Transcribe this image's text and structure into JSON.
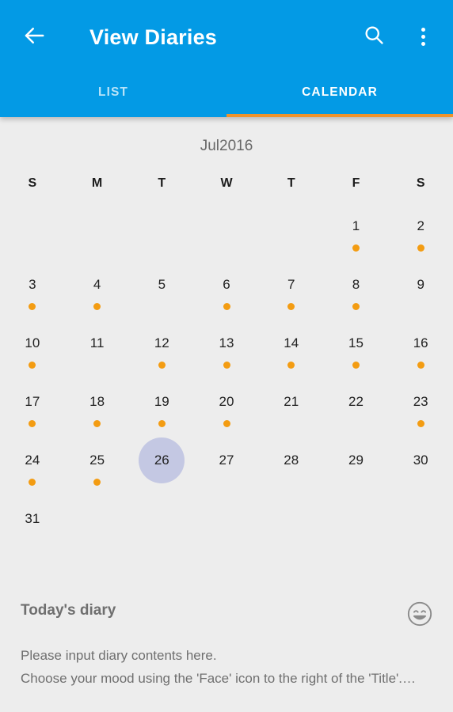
{
  "app_bar": {
    "title": "View Diaries",
    "back_icon": "arrow-left-icon",
    "search_icon": "search-icon",
    "overflow_icon": "more-vert-icon",
    "background_color": "#039ae5"
  },
  "tabs": {
    "items": [
      {
        "label": "LIST",
        "active": false
      },
      {
        "label": "CALENDAR",
        "active": true
      }
    ],
    "indicator_color": "#f0932b"
  },
  "calendar": {
    "month_label": "Jul2016",
    "weekday_headers": [
      "S",
      "M",
      "T",
      "W",
      "T",
      "F",
      "S"
    ],
    "selected_day": 26,
    "dot_color": "#f39c12",
    "selected_circle_color": "#c4c8e3",
    "weeks": [
      [
        {
          "day": "",
          "dot": false
        },
        {
          "day": "",
          "dot": false
        },
        {
          "day": "",
          "dot": false
        },
        {
          "day": "",
          "dot": false
        },
        {
          "day": "",
          "dot": false
        },
        {
          "day": "1",
          "dot": true
        },
        {
          "day": "2",
          "dot": true
        }
      ],
      [
        {
          "day": "3",
          "dot": true
        },
        {
          "day": "4",
          "dot": true
        },
        {
          "day": "5",
          "dot": false
        },
        {
          "day": "6",
          "dot": true
        },
        {
          "day": "7",
          "dot": true
        },
        {
          "day": "8",
          "dot": true
        },
        {
          "day": "9",
          "dot": false
        }
      ],
      [
        {
          "day": "10",
          "dot": true
        },
        {
          "day": "11",
          "dot": false
        },
        {
          "day": "12",
          "dot": true
        },
        {
          "day": "13",
          "dot": true
        },
        {
          "day": "14",
          "dot": true
        },
        {
          "day": "15",
          "dot": true
        },
        {
          "day": "16",
          "dot": true
        }
      ],
      [
        {
          "day": "17",
          "dot": true
        },
        {
          "day": "18",
          "dot": true
        },
        {
          "day": "19",
          "dot": true
        },
        {
          "day": "20",
          "dot": true
        },
        {
          "day": "21",
          "dot": false
        },
        {
          "day": "22",
          "dot": false
        },
        {
          "day": "23",
          "dot": true
        }
      ],
      [
        {
          "day": "24",
          "dot": true
        },
        {
          "day": "25",
          "dot": true
        },
        {
          "day": "26",
          "dot": false,
          "selected": true
        },
        {
          "day": "27",
          "dot": false
        },
        {
          "day": "28",
          "dot": false
        },
        {
          "day": "29",
          "dot": false
        },
        {
          "day": "30",
          "dot": false
        }
      ],
      [
        {
          "day": "31",
          "dot": false
        },
        {
          "day": "",
          "dot": false
        },
        {
          "day": "",
          "dot": false
        },
        {
          "day": "",
          "dot": false
        },
        {
          "day": "",
          "dot": false
        },
        {
          "day": "",
          "dot": false
        },
        {
          "day": "",
          "dot": false
        }
      ]
    ]
  },
  "diary": {
    "title": "Today's diary",
    "mood_icon": "smiley-face-icon",
    "body": "Please input diary contents here.\nChoose your mood using the 'Face' icon to the right of the 'Title'.…"
  }
}
